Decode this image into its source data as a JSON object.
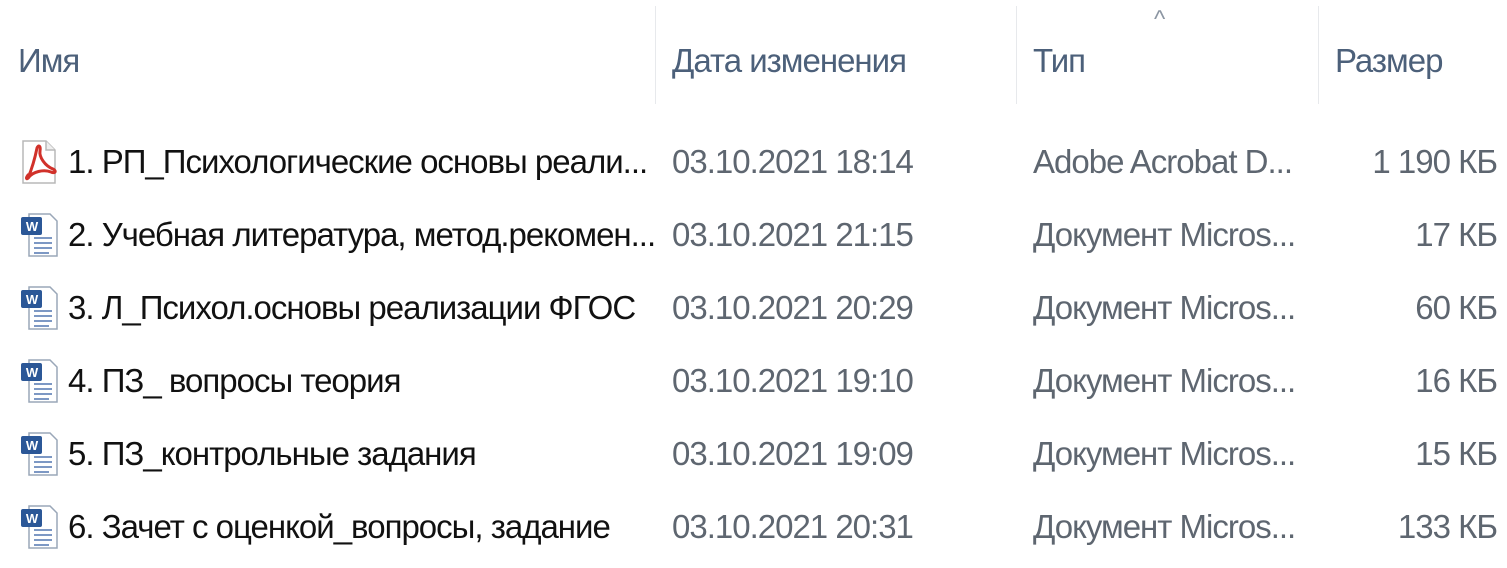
{
  "columns": {
    "name": "Имя",
    "date": "Дата изменения",
    "type": "Тип",
    "size": "Размер"
  },
  "sort_indicator": "^",
  "colors": {
    "header_text": "#4c607a",
    "name_text": "#111111",
    "meta_text": "#5e6670",
    "pdf_red": "#d1312a",
    "word_blue": "#2b5797"
  },
  "files": [
    {
      "icon": "pdf-icon",
      "name": "1. РП_Психологические основы реали...",
      "date": "03.10.2021 18:14",
      "type": "Adobe Acrobat D...",
      "size": "1 190 КБ"
    },
    {
      "icon": "word-icon",
      "name": "2. Учебная литература, метод.рекомен...",
      "date": "03.10.2021 21:15",
      "type": "Документ Micros...",
      "size": "17 КБ"
    },
    {
      "icon": "word-icon",
      "name": "3. Л_Психол.основы реализации ФГОС",
      "date": "03.10.2021 20:29",
      "type": "Документ Micros...",
      "size": "60 КБ"
    },
    {
      "icon": "word-icon",
      "name": "4. ПЗ_ вопросы теория",
      "date": "03.10.2021 19:10",
      "type": "Документ Micros...",
      "size": "16 КБ"
    },
    {
      "icon": "word-icon",
      "name": "5. ПЗ_контрольные задания",
      "date": "03.10.2021 19:09",
      "type": "Документ Micros...",
      "size": "15 КБ"
    },
    {
      "icon": "word-icon",
      "name": "6. Зачет с оценкой_вопросы, задание",
      "date": "03.10.2021 20:31",
      "type": "Документ Micros...",
      "size": "133 КБ"
    }
  ]
}
